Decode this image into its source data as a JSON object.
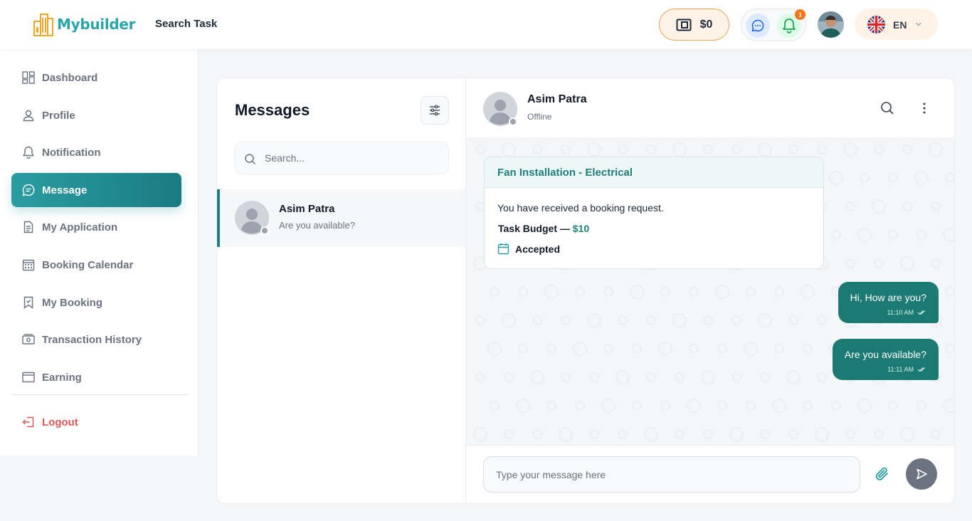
{
  "brand": {
    "name": "Mybuilder",
    "color": "#2aa5a8",
    "logo_icon": "building-logo"
  },
  "header": {
    "nav_link": "Search Task",
    "wallet": {
      "icon": "wallet-icon",
      "amount": "$0"
    },
    "notifications": {
      "badge_count": "1"
    },
    "language": {
      "code": "EN",
      "flag": "uk-flag"
    }
  },
  "sidebar": {
    "items": [
      {
        "label": "Dashboard",
        "icon": "dashboard-icon"
      },
      {
        "label": "Profile",
        "icon": "user-icon"
      },
      {
        "label": "Notification",
        "icon": "bell-icon"
      },
      {
        "label": "Message",
        "icon": "chat-icon",
        "active": true
      },
      {
        "label": "My Application",
        "icon": "document-icon"
      },
      {
        "label": "Booking Calendar",
        "icon": "calendar-icon"
      },
      {
        "label": "My Booking",
        "icon": "bookmark-icon"
      },
      {
        "label": "Transaction History",
        "icon": "money-icon"
      },
      {
        "label": "Earning",
        "icon": "card-icon"
      }
    ],
    "logout_label": "Logout"
  },
  "messages_panel": {
    "title": "Messages",
    "search_placeholder": "Search...",
    "conversations": [
      {
        "name": "Asim Patra",
        "preview": "Are you available?",
        "online": false
      }
    ]
  },
  "chat": {
    "contact": {
      "name": "Asim Patra",
      "status": "Offline"
    },
    "booking_card": {
      "title": "Fan Installation - Electrical",
      "text": "You have received a booking request.",
      "budget_label": "Task Budget —",
      "budget_amount": "$10",
      "status": "Accepted"
    },
    "messages": [
      {
        "text": "Hi, How are you?",
        "time": "11:10 AM",
        "outgoing": true
      },
      {
        "text": "Are you available?",
        "time": "11:11 AM",
        "outgoing": true
      }
    ],
    "composer_placeholder": "Type your message here"
  },
  "colors": {
    "accent": "#1e7f7c",
    "active_nav": "#2a9da2",
    "logout": "#e25555",
    "wallet_border": "#f0a35a",
    "badge": "#f97316"
  }
}
